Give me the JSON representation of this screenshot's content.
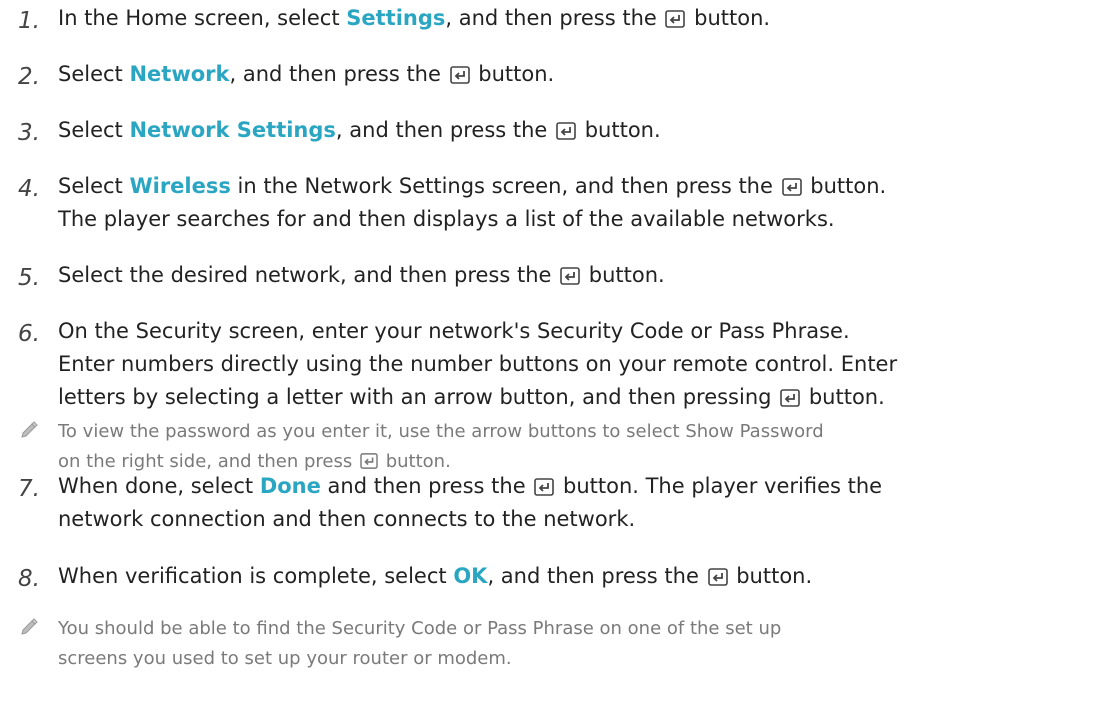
{
  "steps": [
    {
      "num": "1.",
      "parts": [
        "In the Home screen, select ",
        "Settings",
        ", and then press the ",
        " button."
      ]
    },
    {
      "num": "2.",
      "parts": [
        "Select ",
        "Network",
        ", and then press the ",
        " button."
      ]
    },
    {
      "num": "3.",
      "parts": [
        "Select ",
        "Network Settings",
        ", and then press the ",
        " button."
      ]
    },
    {
      "num": "4.",
      "parts": [
        "Select ",
        "Wireless",
        " in the Network Settings screen, and then press the ",
        " button.",
        "The player searches for and then displays a list of the available networks."
      ]
    },
    {
      "num": "5.",
      "parts": [
        "Select the desired network, and then press the ",
        " button."
      ]
    },
    {
      "num": "6.",
      "parts": [
        "On the Security screen, enter your network's Security Code or Pass Phrase.",
        "Enter numbers directly using the number buttons on your remote control. Enter",
        "letters by selecting a letter with an arrow button, and then pressing ",
        " button."
      ]
    },
    {
      "num": "7.",
      "parts": [
        "When done, select ",
        "Done",
        " and then press the ",
        " button. The player verifies the",
        "network connection and then connects to the network."
      ]
    },
    {
      "num": "8.",
      "parts": [
        "When verification is complete, select ",
        "OK",
        ", and then press the ",
        " button."
      ]
    }
  ],
  "notes": [
    {
      "parts": [
        "To view the password as you enter it, use the arrow buttons to select Show Password",
        "on the right side, and then press ",
        " button."
      ]
    },
    {
      "parts": [
        "You should be able to find the Security Code or Pass Phrase on one of the set up",
        "screens you used to set up your router or modem."
      ]
    }
  ],
  "icons": {
    "enter": "enter-button-icon",
    "note": "pencil-icon"
  },
  "colors": {
    "highlight": "#2aa6c3",
    "body_text": "#222222",
    "note_text": "#7a7a7a"
  }
}
